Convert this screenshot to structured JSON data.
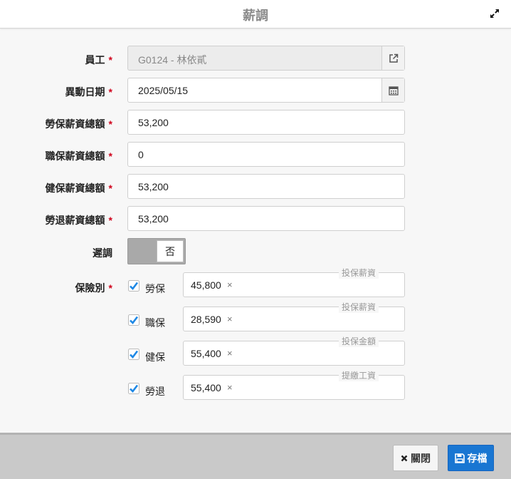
{
  "dialog": {
    "title": "薪調"
  },
  "form": {
    "employee": {
      "label": "員工",
      "value": "G0124 - 林依貳"
    },
    "change_date": {
      "label": "異動日期",
      "value": "2025/05/15"
    },
    "labor_salary_total": {
      "label": "勞保薪資總額",
      "value": "53,200"
    },
    "occupational_salary_total": {
      "label": "職保薪資總額",
      "value": "0"
    },
    "health_salary_total": {
      "label": "健保薪資總額",
      "value": "53,200"
    },
    "pension_salary_total": {
      "label": "勞退薪資總額",
      "value": "53,200"
    },
    "retroactive": {
      "label": "遲調",
      "value": "否"
    },
    "insurance_type": {
      "label": "保險別",
      "items": [
        {
          "name": "勞保",
          "checked": true,
          "value": "45,800",
          "caption": "投保薪資"
        },
        {
          "name": "職保",
          "checked": true,
          "value": "28,590",
          "caption": "投保薪資"
        },
        {
          "name": "健保",
          "checked": true,
          "value": "55,400",
          "caption": "投保金額"
        },
        {
          "name": "勞退",
          "checked": true,
          "value": "55,400",
          "caption": "提繳工資"
        }
      ]
    },
    "required_mark": "*"
  },
  "footer": {
    "close_label": "關閉",
    "save_label": "存檔"
  },
  "colors": {
    "accent": "#1976d2",
    "required": "#d0021b",
    "checkbox": "#1e88e5"
  }
}
